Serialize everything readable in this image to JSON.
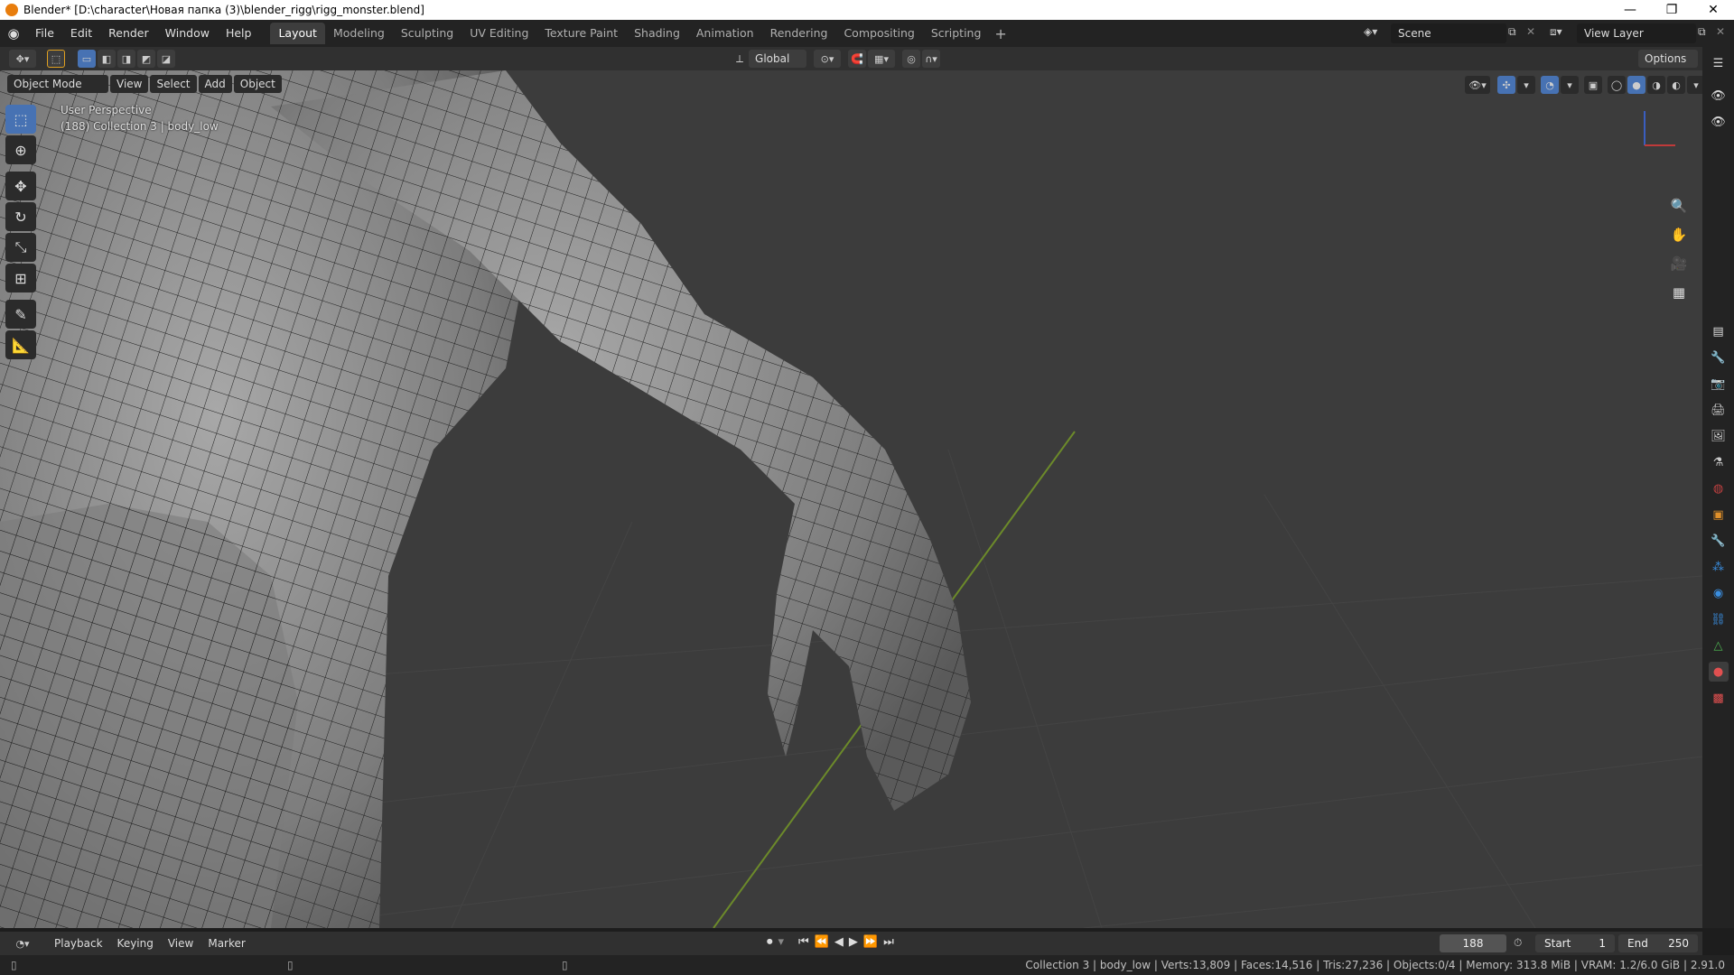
{
  "window": {
    "title": "Blender* [D:\\character\\Новая папка (3)\\blender_rigg\\rigg_monster.blend]",
    "minimize": "—",
    "maximize": "❐",
    "close": "✕"
  },
  "menu": [
    "File",
    "Edit",
    "Render",
    "Window",
    "Help"
  ],
  "workspaces": [
    {
      "label": "Layout",
      "active": true
    },
    {
      "label": "Modeling"
    },
    {
      "label": "Sculpting"
    },
    {
      "label": "UV Editing"
    },
    {
      "label": "Texture Paint"
    },
    {
      "label": "Shading"
    },
    {
      "label": "Animation"
    },
    {
      "label": "Rendering"
    },
    {
      "label": "Compositing"
    },
    {
      "label": "Scripting"
    }
  ],
  "scene": {
    "label": "Scene",
    "view_layer": "View Layer"
  },
  "header": {
    "transform_orientation": "Global",
    "options": "Options"
  },
  "viewport": {
    "mode": "Object Mode",
    "menus": [
      "View",
      "Select",
      "Add",
      "Object"
    ],
    "perspective": "User Perspective",
    "collection_info": "(188) Collection 3 | body_low"
  },
  "timeline": {
    "menus": [
      "Playback",
      "Keying",
      "View",
      "Marker"
    ],
    "current_frame": "188",
    "start_label": "Start",
    "start_value": "1",
    "end_label": "End",
    "end_value": "250"
  },
  "status": {
    "text": "Collection 3 | body_low | Verts:13,809 | Faces:14,516 | Tris:27,236 | Objects:0/4 | Memory: 313.8 MiB | VRAM: 1.2/6.0 GiB | 2.91.0"
  },
  "colors": {
    "active_tool": "#4772b3",
    "grid_axis": "#6c8a2a",
    "mesh": "#8f8f8f"
  }
}
